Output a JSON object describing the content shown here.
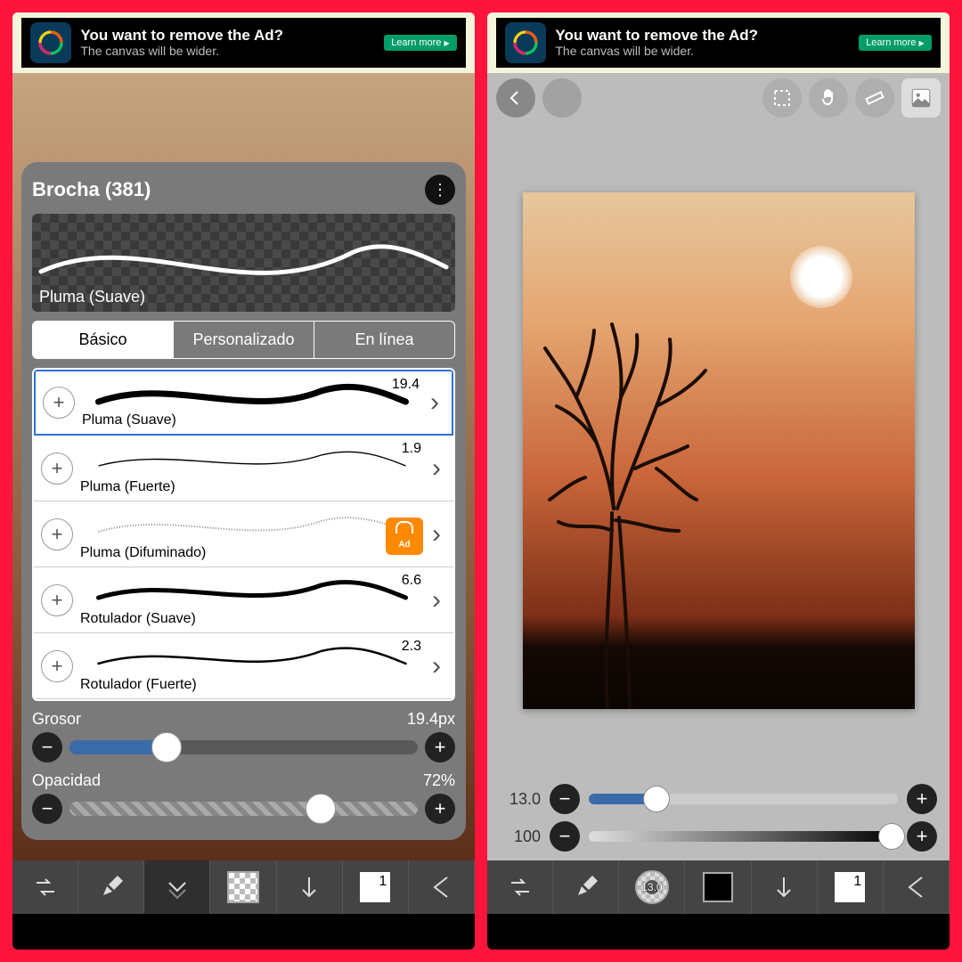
{
  "ad": {
    "line1": "You want to remove the Ad?",
    "line2": "The canvas will be wider.",
    "button": "Learn more"
  },
  "left": {
    "panel_title": "Brocha (381)",
    "preview_label": "Pluma (Suave)",
    "tabs": {
      "basic": "Básico",
      "custom": "Personalizado",
      "online": "En línea"
    },
    "brushes": [
      {
        "name": "Pluma (Suave)",
        "size": "19.4",
        "selected": true,
        "locked": false
      },
      {
        "name": "Pluma (Fuerte)",
        "size": "1.9",
        "selected": false,
        "locked": false
      },
      {
        "name": "Pluma (Difuminado)",
        "size": "",
        "selected": false,
        "locked": true
      },
      {
        "name": "Rotulador (Suave)",
        "size": "6.6",
        "selected": false,
        "locked": false
      },
      {
        "name": "Rotulador (Fuerte)",
        "size": "2.3",
        "selected": false,
        "locked": false
      }
    ],
    "thickness_label": "Grosor",
    "thickness_value": "19.4px",
    "thickness_pct": 28,
    "opacity_label": "Opacidad",
    "opacity_value": "72%",
    "opacity_pct": 72,
    "bottom": {
      "layer_count": "1"
    },
    "lock_text": "Ad"
  },
  "right": {
    "size_label": "13.0",
    "size_pct": 22,
    "opacity_label": "100",
    "opacity_pct": 100,
    "brush_chip": "13.0",
    "layer_count": "1"
  }
}
